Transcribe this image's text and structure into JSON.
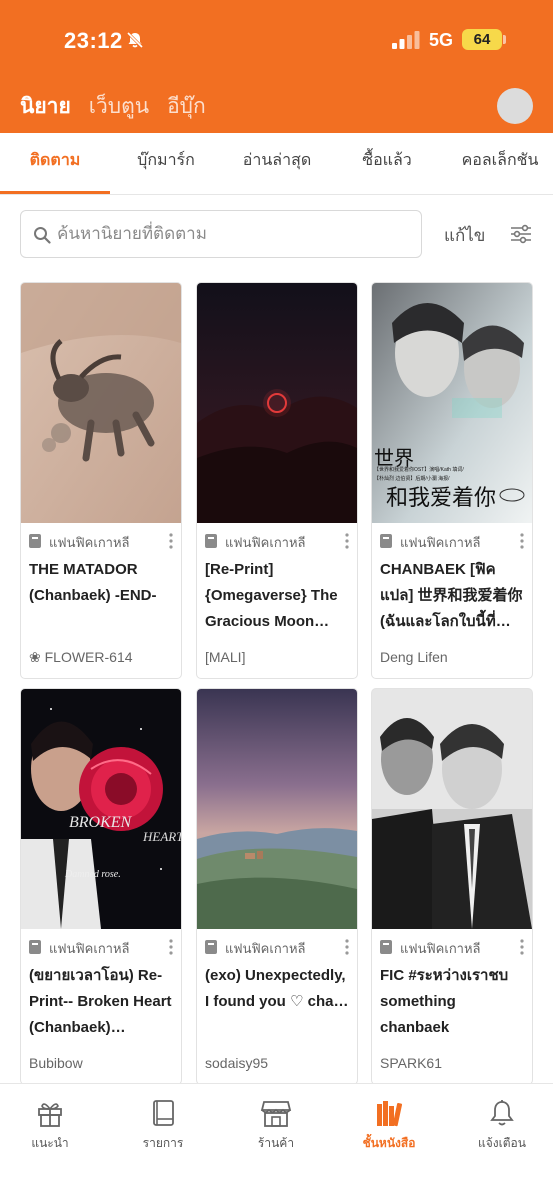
{
  "status": {
    "time": "23:12",
    "network": "5G",
    "battery": "64"
  },
  "top_nav": {
    "items": [
      "นิยาย",
      "เว็บตูน",
      "อีบุ๊ก"
    ],
    "active_index": 0
  },
  "tabs": [
    "ติดตาม",
    "บุ๊กมาร์ก",
    "อ่านล่าสุด",
    "ซื้อแล้ว",
    "คอลเล็กชัน"
  ],
  "search": {
    "placeholder": "ค้นหานิยายที่ติดตาม",
    "edit_label": "แก้ไข"
  },
  "cards": [
    {
      "category": "แฟนฟิคเกาหลี",
      "title": "THE MATADOR (Chanbaek) -END-",
      "author": "❀ FLOWER-614"
    },
    {
      "category": "แฟนฟิคเกาหลี",
      "title": "[Re-Print] {Omegaverse} The Gracious Moon…",
      "author": "[MALI]"
    },
    {
      "category": "แฟนฟิคเกาหลี",
      "title": "CHANBAEK [ฟิคแปล] 世界和我爱着你 (ฉันและโลกใบนี้ที่…",
      "author": "Deng Lifen",
      "cover_text_1": "【世界和我爱着你OST】演唱/Kath 填词/",
      "cover_text_2": "【朴灿烈 边伯贤】后期/小瀾 海报/",
      "cover_text_3": "世界",
      "cover_text_4": "和我爱着你"
    },
    {
      "category": "แฟนฟิคเกาหลี",
      "title": "(ขยายเวลาโอน) Re-Print-- Broken Heart (Chanbaek)…",
      "author": "Bubibow",
      "cover_text_1": "BROKEN",
      "cover_text_2": "HEART",
      "cover_text_3": "Damned rose."
    },
    {
      "category": "แฟนฟิคเกาหลี",
      "title": "(exo) Unexpectedly, I found you ♡ cha…",
      "author": "sodaisy95"
    },
    {
      "category": "แฟนฟิคเกาหลี",
      "title": "FIC #ระหว่างเราชบ something chanbaek",
      "author": "SPARK61"
    }
  ],
  "bottom_nav": {
    "items": [
      "แนะนำ",
      "รายการ",
      "ร้านค้า",
      "ชั้นหนังสือ",
      "แจ้งเตือน"
    ],
    "active_index": 3
  },
  "colors": {
    "brand_orange": "#f26f22",
    "battery_yellow": "#f7d94a"
  },
  "icons": [
    "bell-off-icon",
    "signal-icon",
    "search-icon",
    "filter-icon",
    "book-icon",
    "more-vertical-icon",
    "gift-icon",
    "list-book-icon",
    "store-icon",
    "bookshelf-icon",
    "bell-icon"
  ]
}
